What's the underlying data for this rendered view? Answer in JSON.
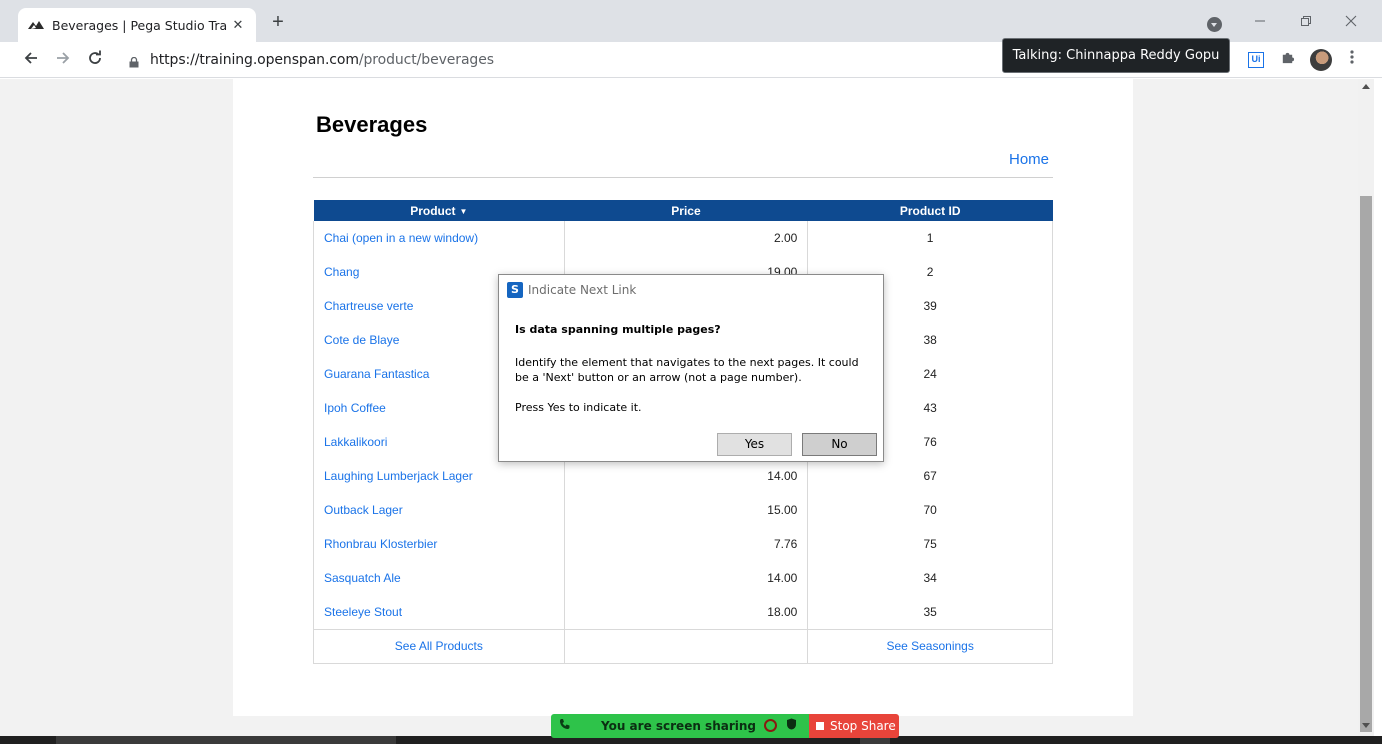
{
  "browser": {
    "tab_title": "Beverages | Pega Studio Training",
    "tab_close": "✕",
    "new_tab": "+",
    "url_host": "https://training.openspan.com",
    "url_path": "/product/beverages",
    "talking": "Talking: Chinnappa Reddy Gopu",
    "ext_ui_label": "Ui",
    "icons": [
      "back-icon",
      "forward-icon",
      "reload-icon",
      "lock-icon",
      "puzzle-icon",
      "kebab-menu-icon"
    ]
  },
  "page": {
    "title": "Beverages",
    "home_link": "Home",
    "table": {
      "headers": [
        "Product",
        "Price",
        "Product ID"
      ],
      "rows": [
        {
          "product": "Chai  (open in a new window)",
          "price": "2.00",
          "id": "1"
        },
        {
          "product": "Chang",
          "price": "19.00",
          "id": "2"
        },
        {
          "product": "Chartreuse verte",
          "price": "",
          "id": "39"
        },
        {
          "product": "Cote de Blaye",
          "price": "",
          "id": "38"
        },
        {
          "product": "Guarana Fantastica",
          "price": "",
          "id": "24"
        },
        {
          "product": "Ipoh Coffee",
          "price": "",
          "id": "43"
        },
        {
          "product": "Lakkalikoori",
          "price": "",
          "id": "76"
        },
        {
          "product": "Laughing Lumberjack Lager",
          "price": "14.00",
          "id": "67"
        },
        {
          "product": "Outback Lager",
          "price": "15.00",
          "id": "70"
        },
        {
          "product": "Rhonbrau Klosterbier",
          "price": "7.76",
          "id": "75"
        },
        {
          "product": "Sasquatch Ale",
          "price": "14.00",
          "id": "34"
        },
        {
          "product": "Steeleye Stout",
          "price": "18.00",
          "id": "35"
        }
      ],
      "footer_left": "See All Products",
      "footer_right": "See Seasonings"
    }
  },
  "dialog": {
    "icon_letter": "S",
    "title": "Indicate Next Link",
    "question": "Is data spanning multiple pages?",
    "body": "Identify the element that navigates to the next pages. It could be a 'Next' button or an arrow (not a page number).",
    "press": "Press Yes to indicate it.",
    "yes_label": "Yes",
    "no_label": "No"
  },
  "share": {
    "status": "You are screen sharing",
    "stop_label": "Stop Share"
  },
  "colors": {
    "header_blue": "#0e4a90",
    "link_blue": "#1a73e8",
    "share_green": "#2ec34a",
    "stop_red": "#e8443a"
  }
}
